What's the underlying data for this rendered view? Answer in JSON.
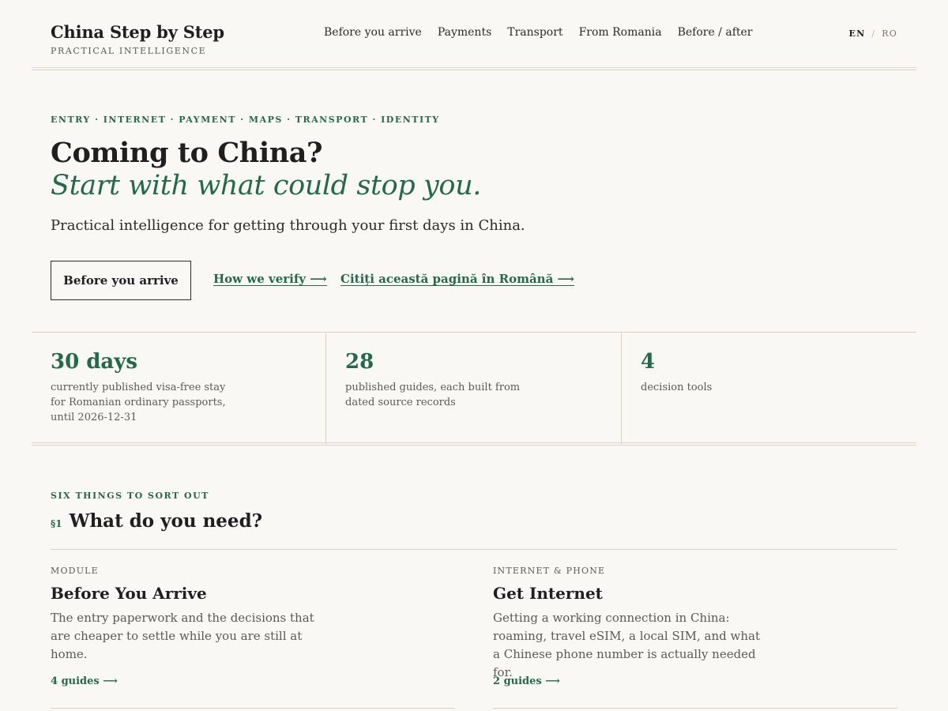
{
  "header": {
    "brand_name": "China Step by Step",
    "brand_sub": "PRACTICAL INTELLIGENCE",
    "nav": [
      "Before you arrive",
      "Payments",
      "Transport",
      "From Romania",
      "Before / after"
    ],
    "lang_en": "EN",
    "lang_sep": "/",
    "lang_ro": "RO"
  },
  "hero": {
    "eyebrow": "ENTRY · INTERNET · PAYMENT · MAPS · TRANSPORT · IDENTITY",
    "title": "Coming to China?",
    "subtitle": "Start with what could stop you.",
    "lead": "Practical intelligence for getting through your first days in China.",
    "primary_button": "Before you arrive",
    "link_verify": "How we verify ⟶",
    "link_romanian": "Citiți această pagină în Română ⟶"
  },
  "stats": [
    {
      "value": "30 days",
      "desc": "currently published visa-free stay for Romanian ordinary passports, until 2026-12-31"
    },
    {
      "value": "28",
      "desc": "published guides, each built from dated source records"
    },
    {
      "value": "4",
      "desc": "decision tools"
    }
  ],
  "section": {
    "eyebrow": "SIX THINGS TO SORT OUT",
    "number": "§1",
    "title": "What do you need?"
  },
  "cards": [
    {
      "tag": "MODULE",
      "title": "Before You Arrive",
      "desc": "The entry paperwork and the decisions that are cheaper to settle while you are still at home.",
      "link": "4 guides ⟶"
    },
    {
      "tag": "INTERNET & PHONE",
      "title": "Get Internet",
      "desc": "Getting a working connection in China: roaming, travel eSIM, a local SIM, and what a Chinese phone number is actually needed for.",
      "link": "2 guides ⟶"
    }
  ],
  "colors": {
    "accent": "#23694a",
    "background": "#faf8f4",
    "rule": "#d9d3c7"
  }
}
